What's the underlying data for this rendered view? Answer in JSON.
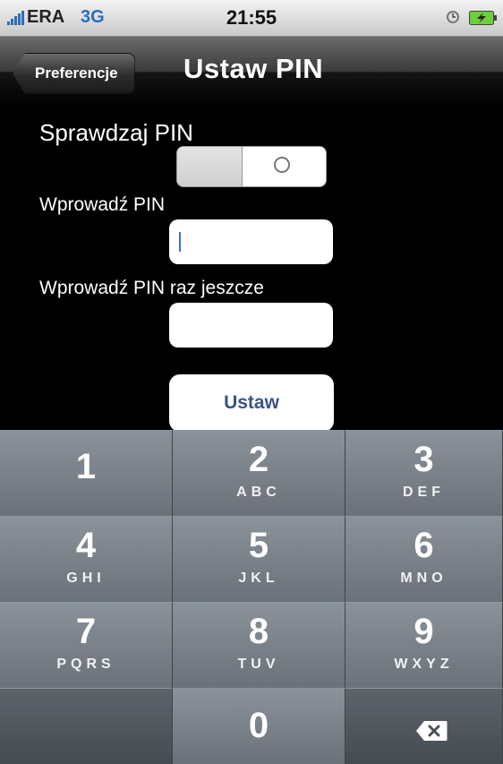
{
  "status_bar": {
    "carrier": "ERA",
    "network": "3G",
    "time": "21:55",
    "icons": [
      "signal-bars-icon",
      "clock-icon",
      "battery-charging-icon"
    ]
  },
  "nav": {
    "back_label": "Preferencje",
    "title": "Ustaw PIN"
  },
  "form": {
    "check_pin_label": "Sprawdzaj PIN",
    "check_pin_state": "off",
    "pin_label": "Wprowadź PIN",
    "pin_value": "",
    "pin_repeat_label": "Wprowadź PIN raz jeszcze",
    "pin_repeat_value": "",
    "set_button": "Ustaw"
  },
  "keypad": {
    "keys": [
      {
        "num": "1",
        "letters": ""
      },
      {
        "num": "2",
        "letters": "ABC"
      },
      {
        "num": "3",
        "letters": "DEF"
      },
      {
        "num": "4",
        "letters": "GHI"
      },
      {
        "num": "5",
        "letters": "JKL"
      },
      {
        "num": "6",
        "letters": "MNO"
      },
      {
        "num": "7",
        "letters": "PQRS"
      },
      {
        "num": "8",
        "letters": "TUV"
      },
      {
        "num": "9",
        "letters": "WXYZ"
      },
      {
        "num": "",
        "letters": ""
      },
      {
        "num": "0",
        "letters": ""
      },
      {
        "num": "",
        "letters": "",
        "icon": "delete-icon"
      }
    ]
  },
  "colors": {
    "accent_blue": "#385487",
    "network_blue": "#2f6db8",
    "background": "#000000"
  }
}
